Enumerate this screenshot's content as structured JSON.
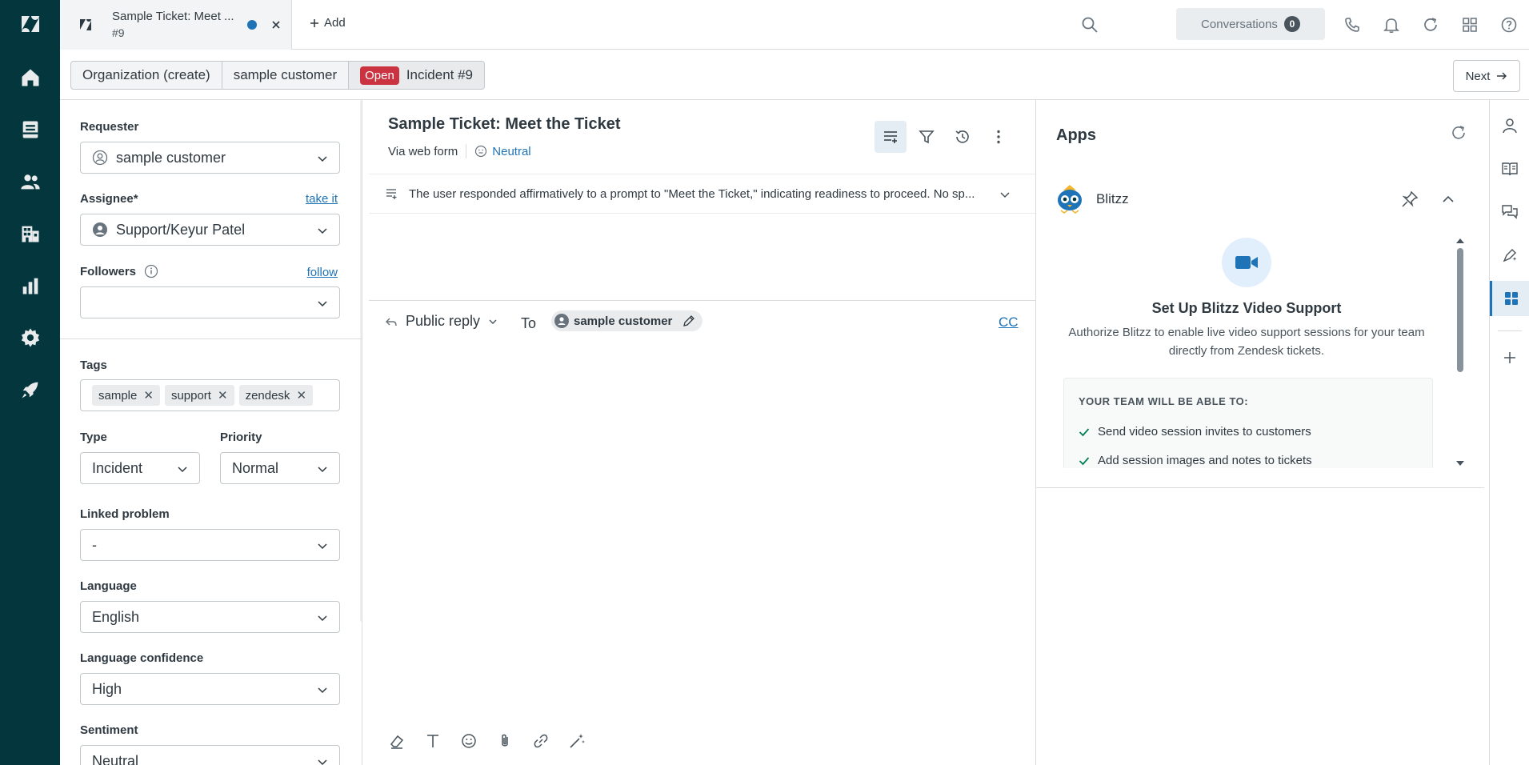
{
  "nav": {
    "items": [
      "logo",
      "home",
      "views",
      "customers",
      "organizations",
      "reporting",
      "admin",
      "get-started"
    ]
  },
  "tabs": [
    {
      "title": "Sample Ticket: Meet ...",
      "subtitle": "#9"
    }
  ],
  "add_tab_label": "Add",
  "conversations": {
    "label": "Conversations",
    "count": "0"
  },
  "breadcrumb": {
    "items": [
      "Organization (create)",
      "sample customer"
    ],
    "status": "Open",
    "current": "Incident #9"
  },
  "next_label": "Next",
  "properties": {
    "requester": {
      "label": "Requester",
      "value": "sample customer"
    },
    "assignee": {
      "label": "Assignee*",
      "link": "take it",
      "value": "Support/Keyur Patel"
    },
    "followers": {
      "label": "Followers",
      "link": "follow",
      "value": ""
    },
    "tags": {
      "label": "Tags",
      "items": [
        "sample",
        "support",
        "zendesk"
      ]
    },
    "type": {
      "label": "Type",
      "value": "Incident"
    },
    "priority": {
      "label": "Priority",
      "value": "Normal"
    },
    "linked_problem": {
      "label": "Linked problem",
      "value": "-"
    },
    "language": {
      "label": "Language",
      "value": "English"
    },
    "language_confidence": {
      "label": "Language confidence",
      "value": "High"
    },
    "sentiment": {
      "label": "Sentiment",
      "value": "Neutral"
    }
  },
  "ticket": {
    "title": "Sample Ticket: Meet the Ticket",
    "via": "Via web form",
    "sentiment": "Neutral",
    "summary": "The user responded affirmatively to a prompt to \"Meet the Ticket,\" indicating readiness to proceed. No sp..."
  },
  "composer": {
    "reply_type": "Public reply",
    "to_label": "To",
    "recipient": "sample customer",
    "cc_label": "CC"
  },
  "apps": {
    "title": "Apps",
    "app_name": "Blitzz",
    "heading": "Set Up Blitzz Video Support",
    "description": "Authorize Blitzz to enable live video support sessions for your team directly from Zendesk tickets.",
    "features_heading": "YOUR TEAM WILL BE ABLE TO:",
    "features": [
      "Send video session invites to customers",
      "Add session images and notes to tickets"
    ]
  },
  "colors": {
    "rail": "#03363d",
    "accent": "#1f73b7",
    "status_open": "#cc3340"
  }
}
